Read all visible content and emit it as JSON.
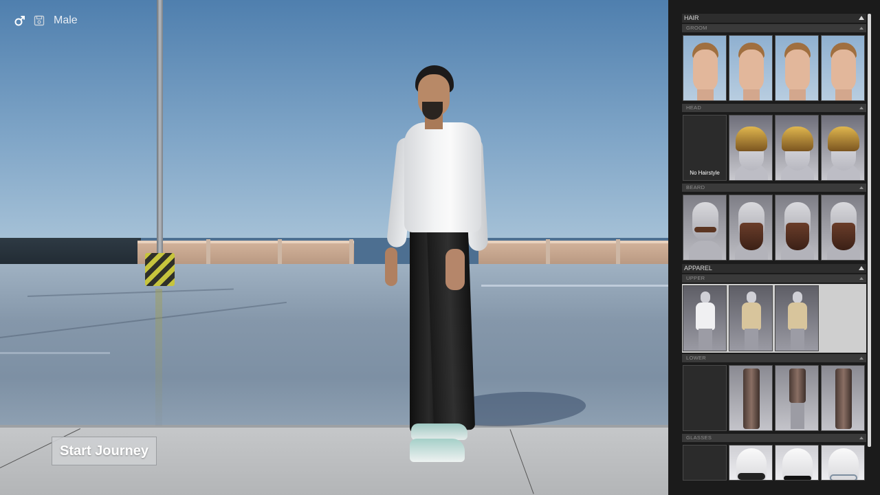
{
  "hud": {
    "gender_icon": "male-symbol-icon",
    "save_icon": "save-icon",
    "gender_label": "Male"
  },
  "start_button": {
    "label": "Start Journey"
  },
  "panel": {
    "hair": {
      "title": "HAIR",
      "groom": {
        "label": "GROOM",
        "items": [
          "groom-1",
          "groom-2",
          "groom-3",
          "groom-4"
        ]
      },
      "head": {
        "label": "HEAD",
        "no_hairstyle_label": "No Hairstyle",
        "items": [
          "hair-1",
          "hair-2",
          "hair-3"
        ]
      },
      "beard": {
        "label": "BEARD",
        "items": [
          "beard-1",
          "beard-2",
          "beard-3",
          "beard-4"
        ]
      }
    },
    "apparel": {
      "title": "APPAREL",
      "upper": {
        "label": "UPPER",
        "items": [
          "white-shirt",
          "cream-sweater",
          "cream-sweater-2"
        ]
      },
      "lower": {
        "label": "LOWER",
        "items": [
          "trousers-1",
          "shorts",
          "trousers-2"
        ]
      },
      "glasses": {
        "label": "GLASSES",
        "items": [
          "glasses-dark",
          "glasses-black",
          "glasses-round"
        ]
      }
    }
  },
  "colors": {
    "panel_bg": "#1b1b1b",
    "header_bg": "#2d2d2d",
    "subheader_bg": "#3a3a3a"
  }
}
